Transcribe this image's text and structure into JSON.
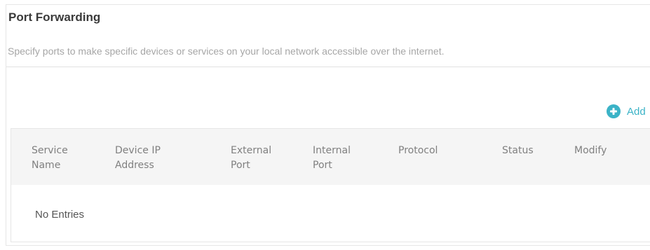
{
  "section": {
    "title": "Port Forwarding",
    "description": "Specify ports to make specific devices or services on your local network accessible over the internet."
  },
  "toolbar": {
    "add_label": "Add",
    "add_icon": "plus-circle-icon",
    "accent_color": "#3bb3c7"
  },
  "table": {
    "columns": [
      {
        "key": "service_name",
        "label": "Service\nName"
      },
      {
        "key": "device_ip",
        "label": "Device IP\nAddress"
      },
      {
        "key": "external_port",
        "label": "External\nPort"
      },
      {
        "key": "internal_port",
        "label": "Internal\nPort"
      },
      {
        "key": "protocol",
        "label": "Protocol"
      },
      {
        "key": "status",
        "label": "Status"
      },
      {
        "key": "modify",
        "label": "Modify"
      }
    ],
    "rows": [],
    "empty_text": "No Entries"
  }
}
